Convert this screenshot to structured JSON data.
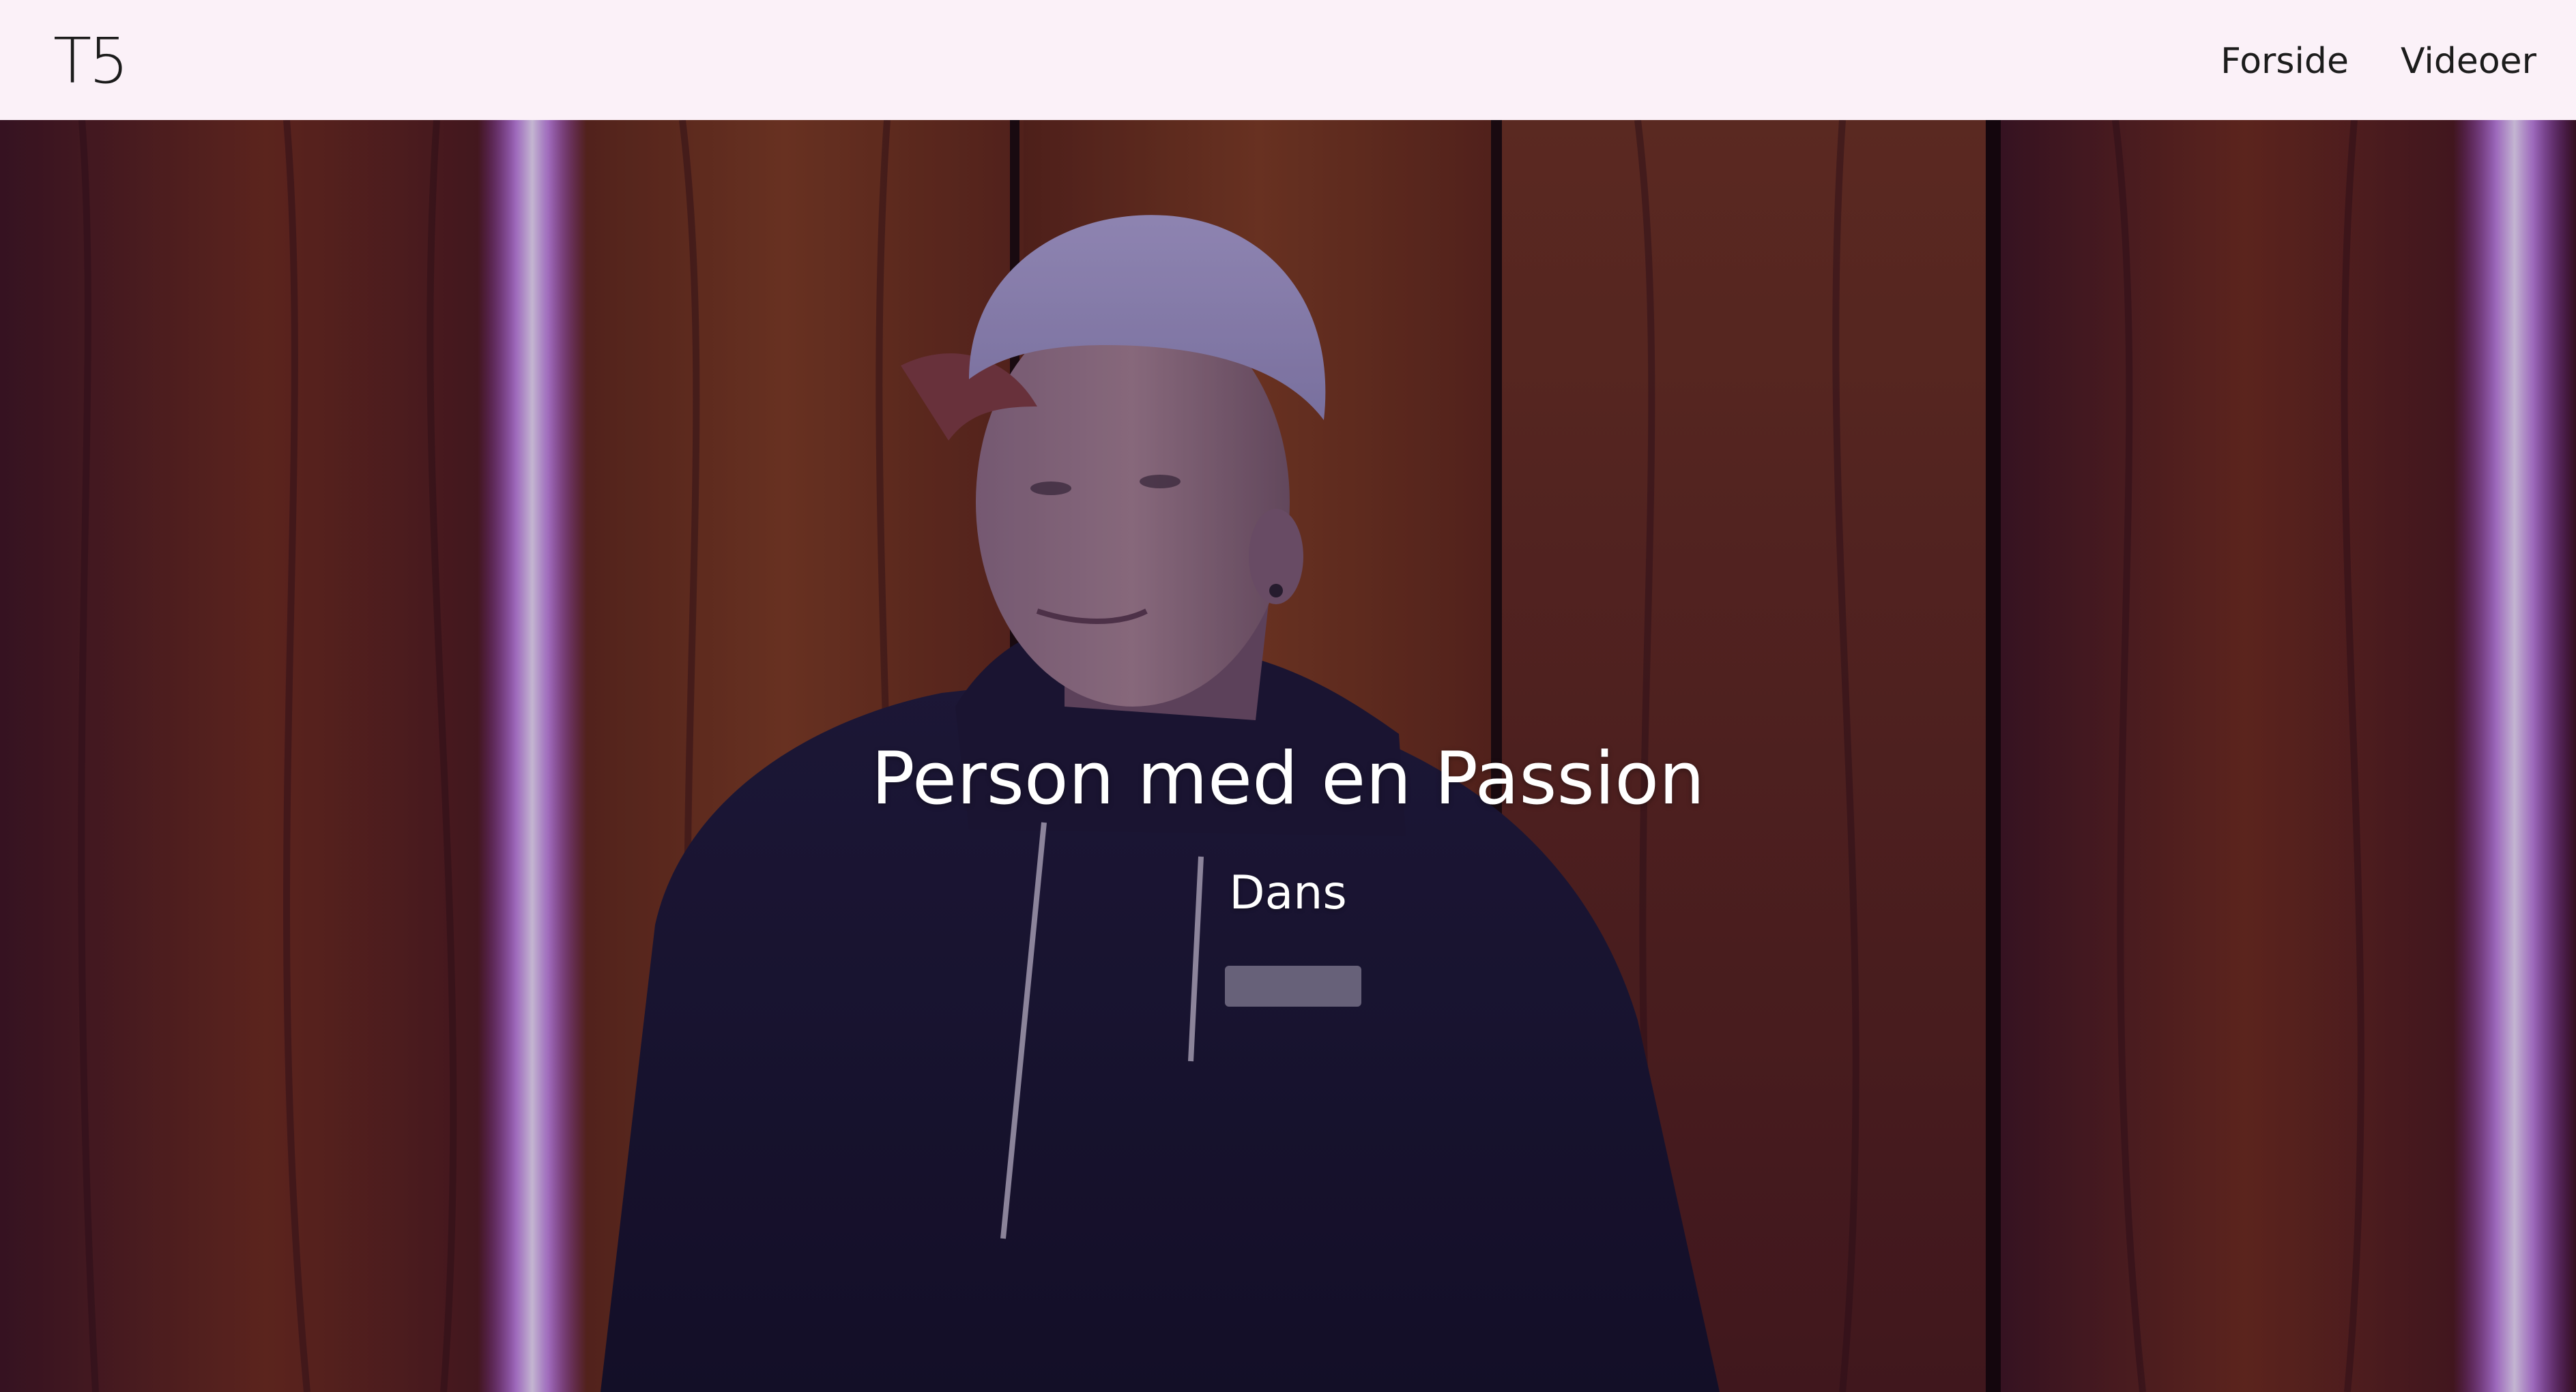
{
  "header": {
    "logo_text": "T5",
    "nav": [
      {
        "label": "Forside"
      },
      {
        "label": "Videoer"
      }
    ]
  },
  "hero": {
    "title": "Person med en Passion",
    "subtitle": "Dans"
  },
  "colors": {
    "header_bg": "#fbf1f8",
    "text_dark": "#1c1c1c",
    "hero_text": "#ffffff",
    "wood": "#5a2218",
    "hoodie": "#1a1630",
    "beanie": "#9e93c4",
    "neon": "#c48cf0"
  }
}
